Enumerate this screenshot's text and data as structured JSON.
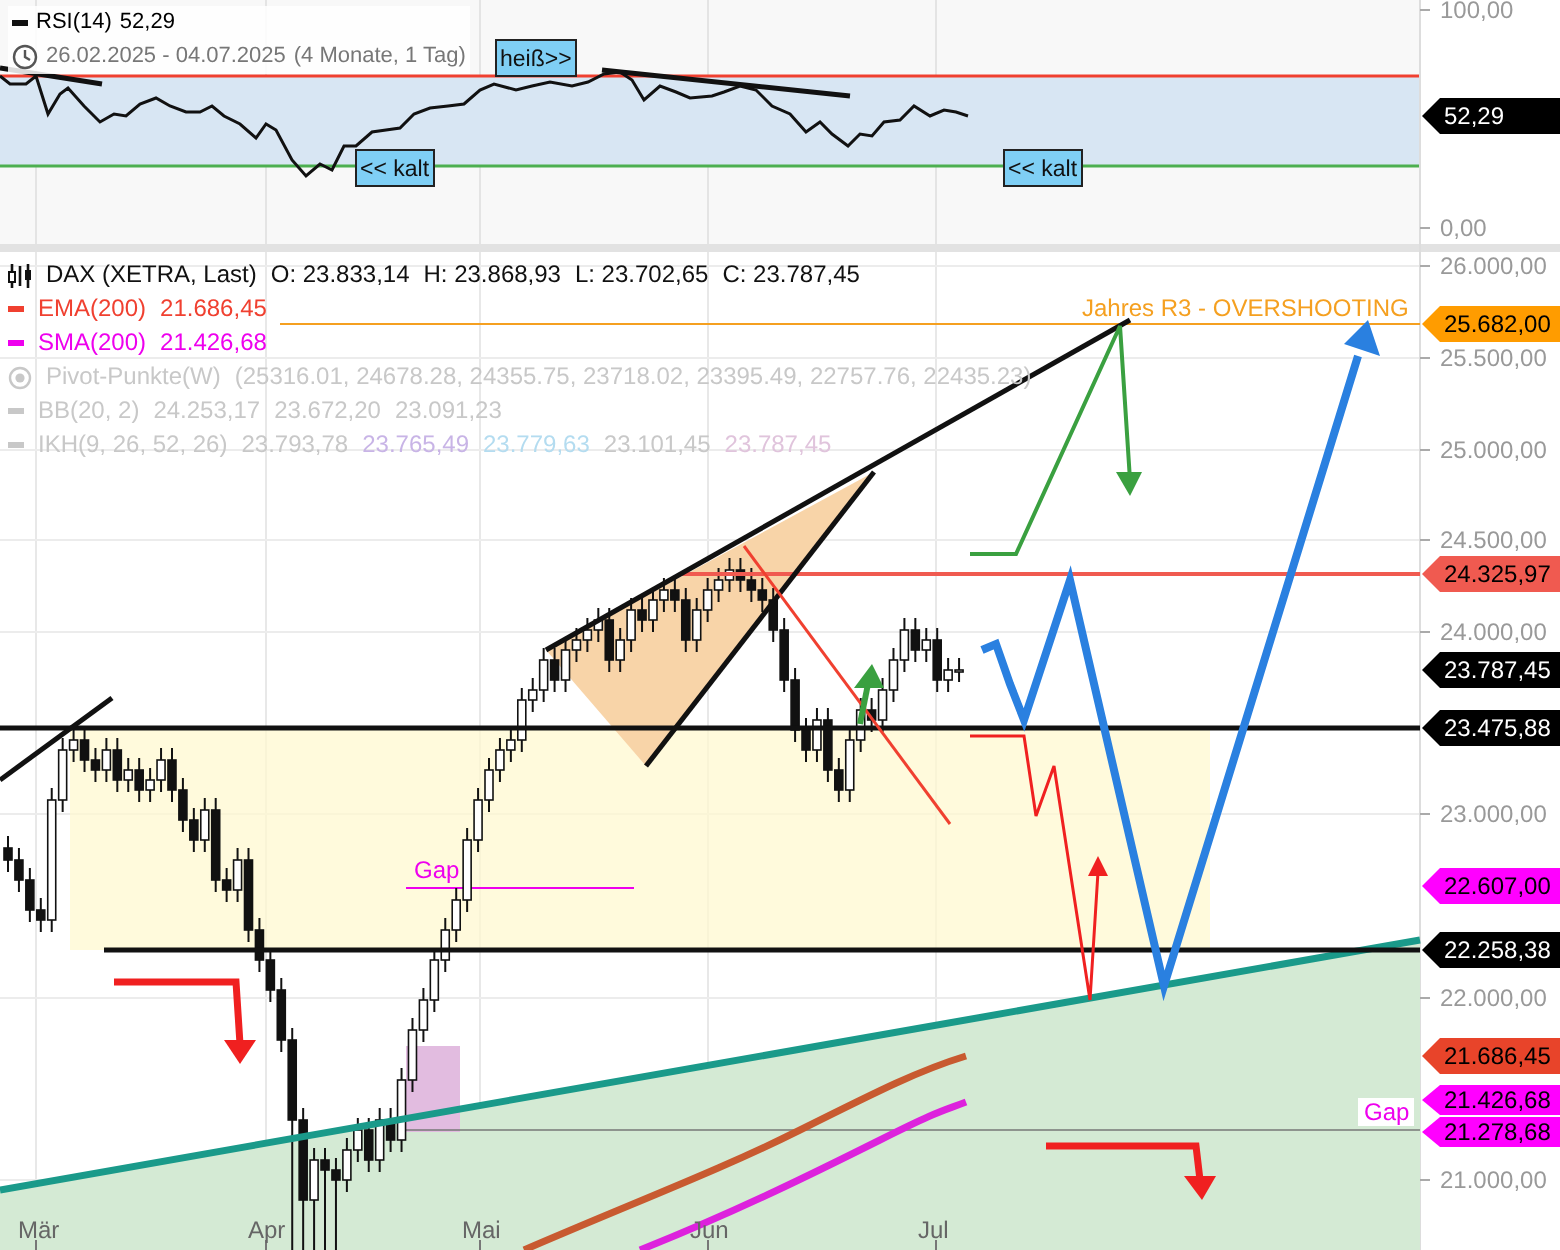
{
  "rsi_panel": {
    "legend": {
      "name": "RSI(14)",
      "value": "52,29"
    },
    "date_range": "26.02.2025 - 04.07.2025",
    "duration": "(4 Monate, 1 Tag)",
    "signals": [
      {
        "text": "heiß>>"
      },
      {
        "text": "<< kalt"
      },
      {
        "text": "<< kalt"
      }
    ],
    "axis_ticks": [
      "100,00",
      "0,00"
    ],
    "price_tag": {
      "text": "52,29",
      "color": "#000000"
    }
  },
  "price_panel": {
    "legend": [
      {
        "kind": "ohlc",
        "name": "DAX (XETRA, Last)",
        "hidden": false,
        "values": [
          {
            "text": "O: 23.833,14"
          },
          {
            "text": "H: 23.868,93"
          },
          {
            "text": "L: 23.702,65"
          },
          {
            "text": "C: 23.787,45"
          }
        ]
      },
      {
        "kind": "line",
        "name": "EMA(200)",
        "color": "#f04030",
        "hidden": false,
        "values": [
          {
            "text": "21.686,45"
          }
        ]
      },
      {
        "kind": "line",
        "name": "SMA(200)",
        "color": "#ee00ee",
        "hidden": false,
        "values": [
          {
            "text": "21.426,68"
          }
        ]
      },
      {
        "kind": "pivot",
        "name": "Pivot-Punkte(W)",
        "hidden": true,
        "values": [
          {
            "text": "(25316.01,  24678.28,  24355.75,  23718.02,  23395.49,  22757.76,  22435.23)"
          }
        ]
      },
      {
        "kind": "line",
        "name": "BB(20, 2)",
        "hidden": true,
        "values": [
          {
            "text": "24.253,17"
          },
          {
            "text": "23.672,20"
          },
          {
            "text": "23.091,23"
          }
        ]
      },
      {
        "kind": "line",
        "name": "IKH(9, 26, 52, 26)",
        "hidden": true,
        "values": [
          {
            "text": "23.793,78"
          },
          {
            "text": "23.765,49",
            "color": "#c8b4e6"
          },
          {
            "text": "23.779,63",
            "color": "#b4dcf0"
          },
          {
            "text": "23.101,45"
          },
          {
            "text": "23.787,45",
            "color": "#e0c4dc"
          }
        ]
      }
    ],
    "axis_ticks": [
      "26.000,00",
      "25.500,00",
      "25.000,00",
      "24.500,00",
      "24.000,00",
      "23.000,00",
      "22.000,00",
      "21.000,00"
    ],
    "price_tags": [
      {
        "text": "25.682,00",
        "color": "#ff9c00"
      },
      {
        "text": "24.325,97",
        "color": "#f05a50"
      },
      {
        "text": "23.787,45",
        "color": "#000000"
      },
      {
        "text": "23.475,88",
        "color": "#000000"
      },
      {
        "text": "22.607,00",
        "color": "#ff00ff"
      },
      {
        "text": "22.258,38",
        "color": "#000000"
      },
      {
        "text": "21.686,45",
        "color": "#e8442a"
      },
      {
        "text": "21.426,68",
        "color": "#ff00ff"
      },
      {
        "text": "21.278,68",
        "color": "#ff00ff"
      }
    ],
    "annotations": [
      {
        "text": "Jahres R3 - OVERSHOOTING",
        "color": "#f5a020"
      },
      {
        "text": "Gap",
        "color": "#ee00ee"
      },
      {
        "text": "Gap",
        "color": "#ee00ee"
      }
    ]
  },
  "x_axis": [
    "Mär",
    "Apr",
    "Mai",
    "Jun",
    "Jul"
  ]
}
